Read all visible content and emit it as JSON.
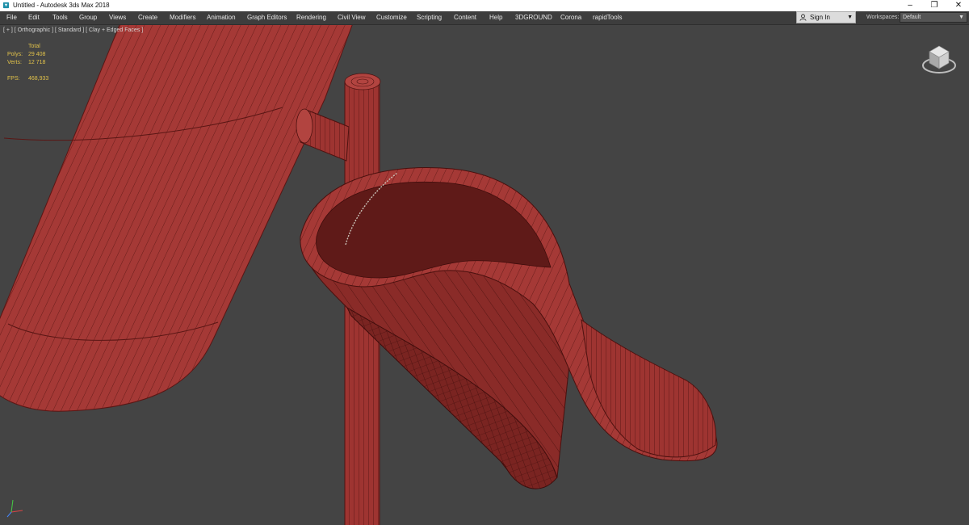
{
  "window": {
    "title": "Untitled - Autodesk 3ds Max 2018",
    "icon": "3dsmax-app-icon",
    "controls": [
      "–",
      "❐",
      "✕"
    ]
  },
  "menu": {
    "items": [
      "File",
      "Edit",
      "Tools",
      "Group",
      "Views",
      "Create",
      "Modifiers",
      "Animation",
      "Graph Editors",
      "Rendering",
      "Civil View",
      "Customize",
      "Scripting",
      "Content",
      "Help",
      "3DGROUND",
      "Corona",
      "rapidTools"
    ]
  },
  "account": {
    "signin_label": "Sign In",
    "workspaces_label": "Workspaces:",
    "workspace_value": "Default"
  },
  "viewport": {
    "label": "[ + ] [ Orthographic ] [ Standard ] [ Clay + Edged Faces ]",
    "stats": {
      "header": "Total",
      "polys_label": "Polys:",
      "polys_value": "29 408",
      "verts_label": "Verts:",
      "verts_value": "12 718",
      "fps_label": "FPS:",
      "fps_value": "468,933"
    },
    "background_color": "#444444",
    "model_color": "#a83a36",
    "stats_color": "#e0c14a"
  }
}
